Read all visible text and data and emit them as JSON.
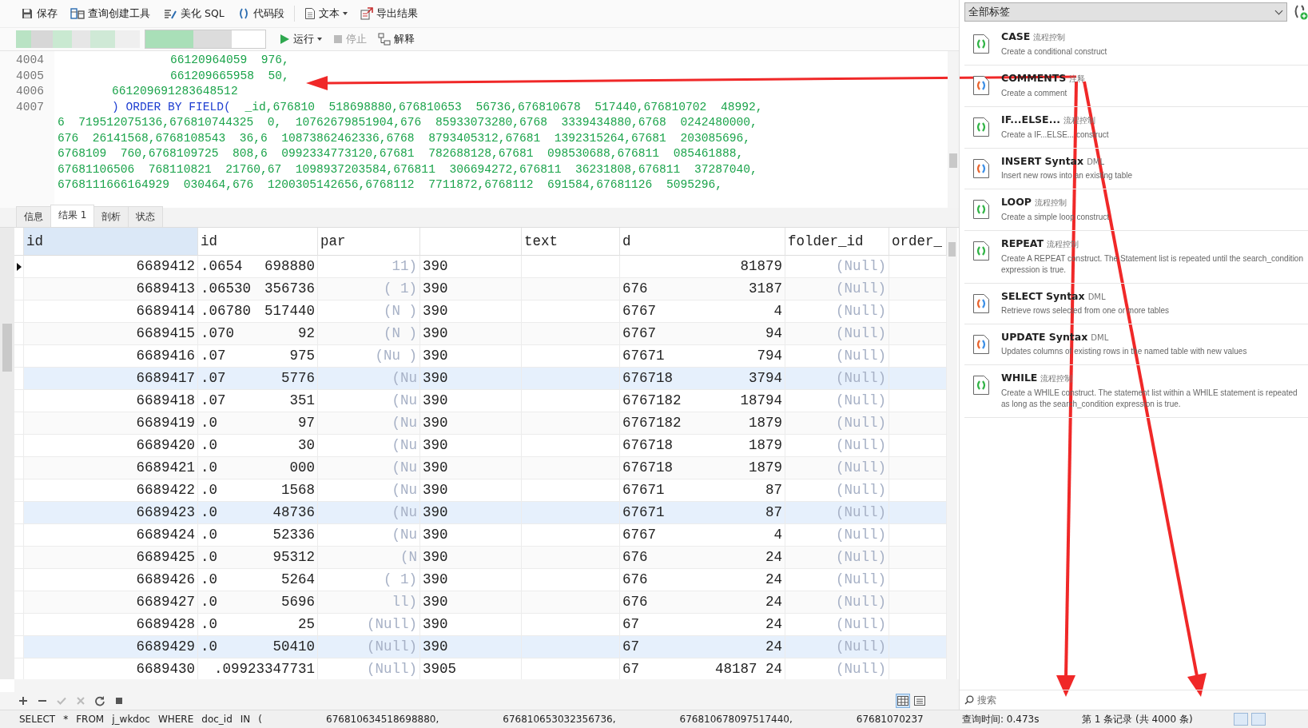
{
  "toolbar": {
    "buttons": [
      {
        "label": "保存",
        "kind": "save",
        "dropdown": false
      },
      {
        "label": "查询创建工具",
        "kind": "builder",
        "dropdown": false
      },
      {
        "label": "美化 SQL",
        "kind": "beautify",
        "dropdown": false
      },
      {
        "label": "代码段",
        "kind": "snippet",
        "dropdown": false
      },
      {
        "label": "文本",
        "kind": "text",
        "dropdown": true
      },
      {
        "label": "导出结果",
        "kind": "export",
        "dropdown": false
      }
    ]
  },
  "run_bar": {
    "buttons": [
      {
        "label": "运行",
        "kind": "run",
        "disabled": false,
        "dropdown": true
      },
      {
        "label": "停止",
        "kind": "stop",
        "disabled": true,
        "dropdown": false
      },
      {
        "label": "解释",
        "kind": "explain",
        "disabled": false,
        "dropdown": false
      }
    ]
  },
  "editor": {
    "lines": [
      {
        "number": "4004",
        "kind": "deep",
        "segments": [
          "66120964059",
          "976,"
        ]
      },
      {
        "number": "4005",
        "kind": "deep",
        "segments": [
          "661209665958",
          "50,"
        ]
      },
      {
        "number": "4006",
        "kind": "mid",
        "segments": [
          "661209691283648512"
        ]
      },
      {
        "number": "4007",
        "kind": "clause",
        "keyword": ") ORDER BY FIELD(",
        "segments": [
          "_id,676810",
          "518698880,676810653",
          "56736,676810678",
          "517440,676810702",
          "48992,"
        ]
      },
      {
        "kind": "wrap",
        "segments": [
          "6",
          "719512075136,676810744325",
          "0,",
          "10762679851904,676",
          "85933073280,6768",
          "3339434880,6768",
          "0242480000,"
        ]
      },
      {
        "kind": "wrap",
        "segments": [
          "676",
          "26141568,6768108543",
          "36,6",
          "10873862462336,6768",
          "8793405312,67681",
          "1392315264,67681",
          "203085696,"
        ]
      },
      {
        "kind": "wrap",
        "segments": [
          "6768109",
          "760,6768109725",
          "808,6",
          "0992334773120,67681",
          "782688128,67681",
          "098530688,676811",
          "085461888,"
        ]
      },
      {
        "kind": "wrap",
        "segments": [
          "67681106506",
          "768110821",
          "21760,67",
          "1098937203584,676811",
          "306694272,676811",
          "36231808,676811",
          "37287040,"
        ]
      },
      {
        "kind": "wrap",
        "segments": [
          "6768111666164929",
          "030464,676",
          "1200305142656,6768112",
          "7711872,6768112",
          "691584,67681126",
          "5095296,"
        ]
      }
    ]
  },
  "result_tabs": [
    {
      "label": "信息",
      "selected": false
    },
    {
      "label": "结果 1",
      "selected": true
    },
    {
      "label": "剖析",
      "selected": false
    },
    {
      "label": "状态",
      "selected": false
    }
  ],
  "table": {
    "columns": [
      {
        "label": "id"
      },
      {
        "label": "id"
      },
      {
        "label": "par"
      },
      {},
      {
        "label": "text"
      },
      {
        "label": "d"
      },
      {
        "label": "folder_id"
      },
      {
        "label": "order_"
      }
    ],
    "rows": [
      {
        "selected": true,
        "highlighted": false,
        "id": "6689412",
        "id_2": [
          ".0654",
          "698880"
        ],
        "parent": "11)",
        "col_4": "390",
        "col_6": [
          "81879"
        ],
        "folder_id": "(Null)"
      },
      {
        "selected": false,
        "highlighted": false,
        "id": "6689413",
        "id_2": [
          ".06530",
          "356736"
        ],
        "parent": "(  1)",
        "col_4": "390",
        "col_6": [
          "676",
          "3187"
        ],
        "folder_id": "(Null)"
      },
      {
        "selected": false,
        "highlighted": false,
        "id": "6689414",
        "id_2": [
          ".06780",
          "517440"
        ],
        "parent": "(N  )",
        "col_4": "390",
        "col_6": [
          "6767",
          "4"
        ],
        "folder_id": "(Null)"
      },
      {
        "selected": false,
        "highlighted": false,
        "id": "6689415",
        "id_2": [
          ".070",
          "92"
        ],
        "parent": "(N  )",
        "col_4": "390",
        "col_6": [
          "6767",
          "94"
        ],
        "folder_id": "(Null)"
      },
      {
        "selected": false,
        "highlighted": false,
        "id": "6689416",
        "id_2": [
          ".07",
          "975"
        ],
        "parent": "(Nu )",
        "col_4": "390",
        "col_6": [
          "67671",
          "794"
        ],
        "folder_id": "(Null)"
      },
      {
        "selected": false,
        "highlighted": true,
        "id": "6689417",
        "id_2": [
          ".07",
          "5776"
        ],
        "parent": "(Nu",
        "col_4": "390",
        "col_6": [
          "676718",
          "3794"
        ],
        "folder_id": "(Null)"
      },
      {
        "selected": false,
        "highlighted": false,
        "id": "6689418",
        "id_2": [
          ".07",
          "351"
        ],
        "parent": "(Nu",
        "col_4": "390",
        "col_6": [
          "6767182",
          "18794"
        ],
        "folder_id": "(Null)"
      },
      {
        "selected": false,
        "highlighted": false,
        "id": "6689419",
        "id_2": [
          ".0",
          "97"
        ],
        "parent": "(Nu",
        "col_4": "390",
        "col_6": [
          "6767182",
          "1879"
        ],
        "folder_id": "(Null)"
      },
      {
        "selected": false,
        "highlighted": false,
        "id": "6689420",
        "id_2": [
          ".0",
          "30"
        ],
        "parent": "(Nu",
        "col_4": "390",
        "col_6": [
          "676718",
          "1879"
        ],
        "folder_id": "(Null)"
      },
      {
        "selected": false,
        "highlighted": false,
        "id": "6689421",
        "id_2": [
          ".0",
          "000"
        ],
        "parent": "(Nu",
        "col_4": "390",
        "col_6": [
          "676718",
          "1879"
        ],
        "folder_id": "(Null)"
      },
      {
        "selected": false,
        "highlighted": false,
        "id": "6689422",
        "id_2": [
          ".0",
          "1568"
        ],
        "parent": "(Nu",
        "col_4": "390",
        "col_6": [
          "67671",
          "87"
        ],
        "folder_id": "(Null)"
      },
      {
        "selected": false,
        "highlighted": true,
        "id": "6689423",
        "id_2": [
          ".0",
          "48736"
        ],
        "parent": "(Nu",
        "col_4": "390",
        "col_6": [
          "67671",
          "87"
        ],
        "folder_id": "(Null)"
      },
      {
        "selected": false,
        "highlighted": false,
        "id": "6689424",
        "id_2": [
          ".0",
          "52336"
        ],
        "parent": "(Nu",
        "col_4": "390",
        "col_6": [
          "6767",
          "4"
        ],
        "folder_id": "(Null)"
      },
      {
        "selected": false,
        "highlighted": false,
        "id": "6689425",
        "id_2": [
          ".0",
          "95312"
        ],
        "parent": "(N",
        "col_4": "390",
        "col_6": [
          "676",
          "24"
        ],
        "folder_id": "(Null)"
      },
      {
        "selected": false,
        "highlighted": false,
        "id": "6689426",
        "id_2": [
          ".0",
          "5264"
        ],
        "parent": "(  1)",
        "col_4": "390",
        "col_6": [
          "676",
          "24"
        ],
        "folder_id": "(Null)"
      },
      {
        "selected": false,
        "highlighted": false,
        "id": "6689427",
        "id_2": [
          ".0",
          "5696"
        ],
        "parent": "ll)",
        "col_4": "390",
        "col_6": [
          "676",
          "24"
        ],
        "folder_id": "(Null)"
      },
      {
        "selected": false,
        "highlighted": false,
        "id": "6689428",
        "id_2": [
          ".0",
          "25"
        ],
        "parent": "(Null)",
        "col_4": "390",
        "col_6": [
          "67",
          "24"
        ],
        "folder_id": "(Null)"
      },
      {
        "selected": false,
        "highlighted": true,
        "id": "6689429",
        "id_2": [
          ".0",
          "50410"
        ],
        "parent": "(Null)",
        "col_4": "390",
        "col_6": [
          "67",
          "24"
        ],
        "folder_id": "(Null)"
      },
      {
        "selected": false,
        "highlighted": false,
        "id": "6689430",
        "id_2": [
          ".09923347731"
        ],
        "parent": "(Null)",
        "col_4": "3905",
        "col_6": [
          "67",
          "48187 24"
        ],
        "folder_id": "(Null)"
      }
    ]
  },
  "grid_tools": [
    {
      "kind": "add",
      "disabled": false
    },
    {
      "kind": "remove",
      "disabled": false
    },
    {
      "kind": "apply",
      "disabled": true
    },
    {
      "kind": "discard",
      "disabled": true
    },
    {
      "kind": "refresh",
      "disabled": false
    },
    {
      "kind": "stop",
      "disabled": false
    }
  ],
  "view_modes": [
    {
      "kind": "grid",
      "selected": true
    },
    {
      "kind": "form",
      "selected": false
    }
  ],
  "snippets": {
    "filter": "全部标签",
    "items": [
      {
        "title": "CASE",
        "category": "流程控制",
        "description": "Create a conditional construct",
        "kind": "green"
      },
      {
        "title": "COMMENTS",
        "category": "注释",
        "description": "Create a comment",
        "kind": "colored"
      },
      {
        "title": "IF...ELSE...",
        "category": "流程控制",
        "description": "Create a IF...ELSE... construct",
        "kind": "green"
      },
      {
        "title": "INSERT Syntax",
        "category": "DML",
        "description": "Insert new rows into an existing table",
        "kind": "colored"
      },
      {
        "title": "LOOP",
        "category": "流程控制",
        "description": "Create a simple loop construct",
        "kind": "green"
      },
      {
        "title": "REPEAT",
        "category": "流程控制",
        "description": "Create A REPEAT construct. The Statement list is repeated until the search_condition expression is true.",
        "kind": "green"
      },
      {
        "title": "SELECT Syntax",
        "category": "DML",
        "description": "Retrieve rows selected from one or more tables",
        "kind": "colored"
      },
      {
        "title": "UPDATE Syntax",
        "category": "DML",
        "description": "Updates columns of existing rows in the named table with new values",
        "kind": "colored"
      },
      {
        "title": "WHILE",
        "category": "流程控制",
        "description": "Create a WHILE construct. The statement list within a WHILE statement is repeated as long as the search_condition expression is true.",
        "kind": "green"
      }
    ],
    "search": {
      "placeholder": "搜索"
    }
  },
  "status_bar": {
    "sql": [
      "SELECT",
      "*",
      "FROM",
      "j_wkdoc",
      "WHERE",
      "doc_id",
      "IN",
      "(",
      "676810634518698880,",
      "676810653032356736,",
      "676810678097517440,",
      "67681070237"
    ],
    "query_time": "查询时间: 0.473s",
    "record": "第 1 条记录 (共 4000 条)"
  },
  "annotations": [
    {
      "kind": "arrow"
    },
    {
      "kind": "arrow"
    },
    {
      "kind": "arrow"
    }
  ]
}
